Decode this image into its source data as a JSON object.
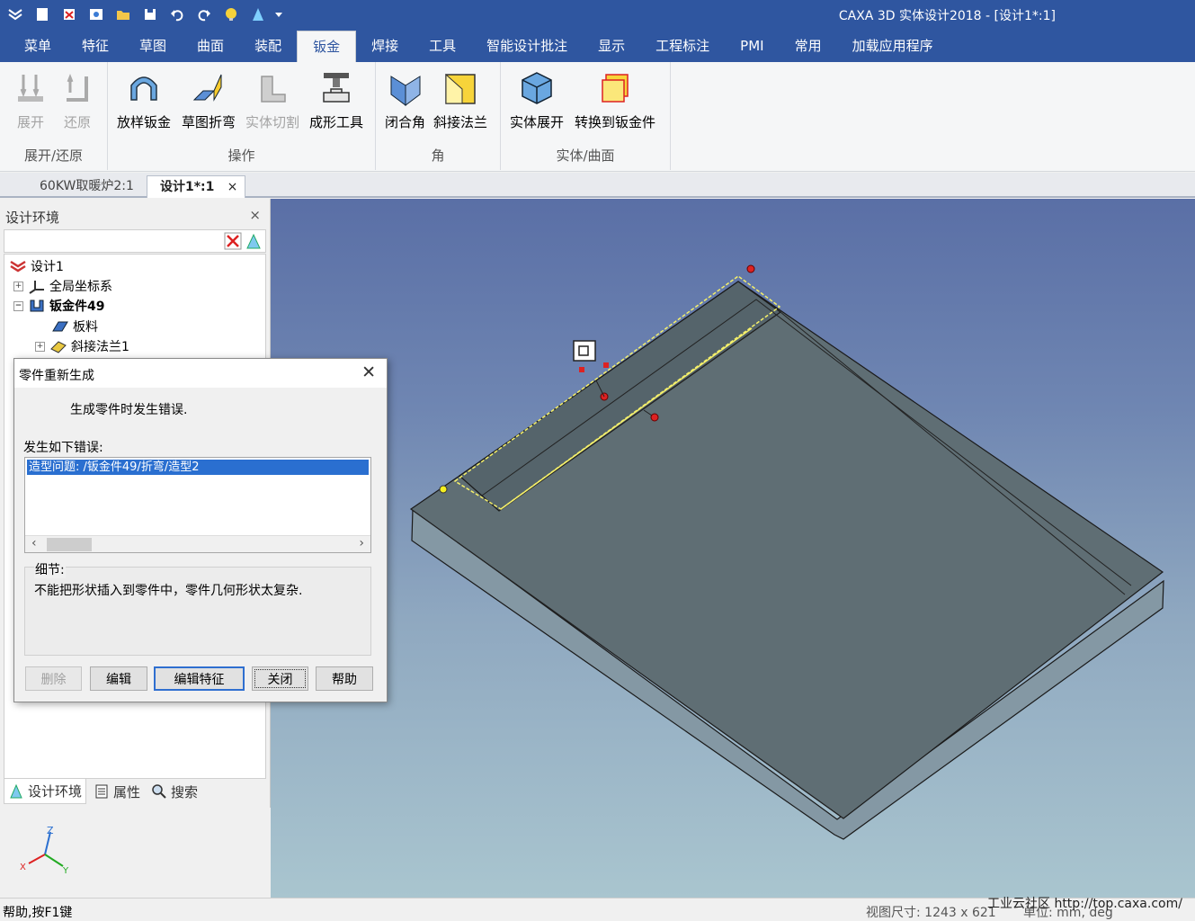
{
  "window": {
    "title": "CAXA 3D 实体设计2018 - [设计1*:1]"
  },
  "qat": [
    "app-menu-icon",
    "new-icon",
    "save-red-icon",
    "print-preview-icon",
    "open-folder-icon",
    "save-icon",
    "undo-icon",
    "redo-icon",
    "bulb-icon",
    "tree-icon",
    "dropdown-arrow-icon"
  ],
  "menu": {
    "tabs": [
      "菜单",
      "特征",
      "草图",
      "曲面",
      "装配",
      "钣金",
      "焊接",
      "工具",
      "智能设计批注",
      "显示",
      "工程标注",
      "PMI",
      "常用",
      "加载应用程序"
    ],
    "active": "钣金"
  },
  "ribbon": {
    "groups": [
      {
        "label": "展开/还原",
        "buttons": [
          {
            "label": "展开",
            "disabled": true
          },
          {
            "label": "还原",
            "disabled": true
          }
        ]
      },
      {
        "label": "操作",
        "buttons": [
          {
            "label": "放样钣金"
          },
          {
            "label": "草图折弯"
          },
          {
            "label": "实体切割",
            "disabled": true
          },
          {
            "label": "成形工具"
          }
        ]
      },
      {
        "label": "角",
        "buttons": [
          {
            "label": "闭合角"
          },
          {
            "label": "斜接法兰"
          }
        ]
      },
      {
        "label": "实体/曲面",
        "buttons": [
          {
            "label": "实体展开"
          },
          {
            "label": "转换到钣金件"
          }
        ]
      }
    ]
  },
  "doc_tabs": [
    {
      "label": "60KW取暖炉2:1"
    },
    {
      "label": "设计1*:1",
      "active": true,
      "close": "×"
    }
  ],
  "panel": {
    "title": "设计环境",
    "close": "×",
    "tree": [
      {
        "label": "设计1",
        "icon": "design-icon"
      },
      {
        "label": "全局坐标系",
        "icon": "axes-icon",
        "expander": "+"
      },
      {
        "label": "钣金件49",
        "icon": "sheetmetal-icon",
        "expander": "−"
      },
      {
        "label": "板料",
        "icon": "plate-icon"
      },
      {
        "label": "斜接法兰1",
        "icon": "flange-icon",
        "expander": "+"
      }
    ],
    "bottom_tabs": [
      "设计环境",
      "属性",
      "搜索"
    ]
  },
  "dialog": {
    "title": "零件重新生成",
    "close": "✕",
    "message": "生成零件时发生错误.",
    "errors_label": "发生如下错误:",
    "errors": [
      "造型问题: /钣金件49/折弯/造型2"
    ],
    "scroll_left": "‹",
    "scroll_right": "›",
    "details_label": "细节:",
    "details": "不能把形状插入到零件中，零件几何形状太复杂.",
    "buttons": [
      {
        "label": "删除",
        "disabled": true
      },
      {
        "label": "编辑"
      },
      {
        "label": "编辑特征",
        "default": true
      },
      {
        "label": "关闭"
      },
      {
        "label": "帮助"
      }
    ]
  },
  "axes": {
    "z": "Z",
    "x": "X",
    "y": "Y"
  },
  "status": {
    "help": "帮助,按F1键",
    "view_size": "视图尺寸: 1243 x 621",
    "units": "单位: mm, deg"
  },
  "watermark": "工业云社区 http://top.caxa.com/"
}
